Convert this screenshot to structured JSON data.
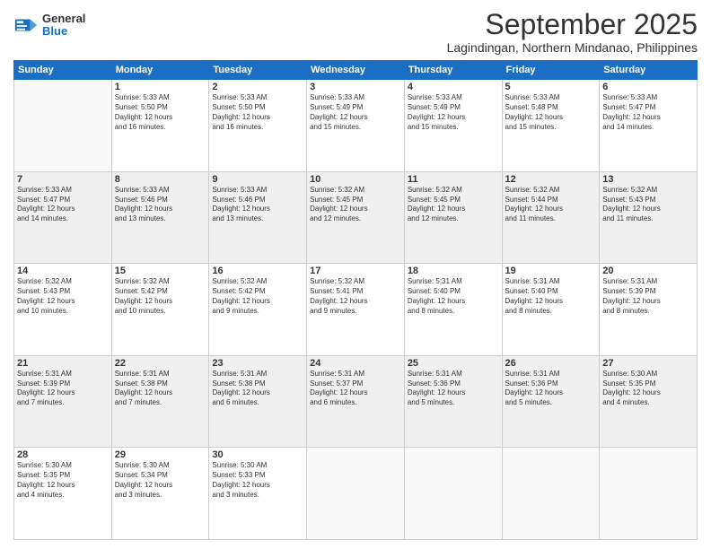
{
  "header": {
    "logo_general": "General",
    "logo_blue": "Blue",
    "month_title": "September 2025",
    "location": "Lagindingan, Northern Mindanao, Philippines"
  },
  "weekdays": [
    "Sunday",
    "Monday",
    "Tuesday",
    "Wednesday",
    "Thursday",
    "Friday",
    "Saturday"
  ],
  "weeks": [
    [
      {
        "day": "",
        "info": ""
      },
      {
        "day": "1",
        "info": "Sunrise: 5:33 AM\nSunset: 5:50 PM\nDaylight: 12 hours\nand 16 minutes."
      },
      {
        "day": "2",
        "info": "Sunrise: 5:33 AM\nSunset: 5:50 PM\nDaylight: 12 hours\nand 16 minutes."
      },
      {
        "day": "3",
        "info": "Sunrise: 5:33 AM\nSunset: 5:49 PM\nDaylight: 12 hours\nand 15 minutes."
      },
      {
        "day": "4",
        "info": "Sunrise: 5:33 AM\nSunset: 5:49 PM\nDaylight: 12 hours\nand 15 minutes."
      },
      {
        "day": "5",
        "info": "Sunrise: 5:33 AM\nSunset: 5:48 PM\nDaylight: 12 hours\nand 15 minutes."
      },
      {
        "day": "6",
        "info": "Sunrise: 5:33 AM\nSunset: 5:47 PM\nDaylight: 12 hours\nand 14 minutes."
      }
    ],
    [
      {
        "day": "7",
        "info": "Sunrise: 5:33 AM\nSunset: 5:47 PM\nDaylight: 12 hours\nand 14 minutes."
      },
      {
        "day": "8",
        "info": "Sunrise: 5:33 AM\nSunset: 5:46 PM\nDaylight: 12 hours\nand 13 minutes."
      },
      {
        "day": "9",
        "info": "Sunrise: 5:33 AM\nSunset: 5:46 PM\nDaylight: 12 hours\nand 13 minutes."
      },
      {
        "day": "10",
        "info": "Sunrise: 5:32 AM\nSunset: 5:45 PM\nDaylight: 12 hours\nand 12 minutes."
      },
      {
        "day": "11",
        "info": "Sunrise: 5:32 AM\nSunset: 5:45 PM\nDaylight: 12 hours\nand 12 minutes."
      },
      {
        "day": "12",
        "info": "Sunrise: 5:32 AM\nSunset: 5:44 PM\nDaylight: 12 hours\nand 11 minutes."
      },
      {
        "day": "13",
        "info": "Sunrise: 5:32 AM\nSunset: 5:43 PM\nDaylight: 12 hours\nand 11 minutes."
      }
    ],
    [
      {
        "day": "14",
        "info": "Sunrise: 5:32 AM\nSunset: 5:43 PM\nDaylight: 12 hours\nand 10 minutes."
      },
      {
        "day": "15",
        "info": "Sunrise: 5:32 AM\nSunset: 5:42 PM\nDaylight: 12 hours\nand 10 minutes."
      },
      {
        "day": "16",
        "info": "Sunrise: 5:32 AM\nSunset: 5:42 PM\nDaylight: 12 hours\nand 9 minutes."
      },
      {
        "day": "17",
        "info": "Sunrise: 5:32 AM\nSunset: 5:41 PM\nDaylight: 12 hours\nand 9 minutes."
      },
      {
        "day": "18",
        "info": "Sunrise: 5:31 AM\nSunset: 5:40 PM\nDaylight: 12 hours\nand 8 minutes."
      },
      {
        "day": "19",
        "info": "Sunrise: 5:31 AM\nSunset: 5:40 PM\nDaylight: 12 hours\nand 8 minutes."
      },
      {
        "day": "20",
        "info": "Sunrise: 5:31 AM\nSunset: 5:39 PM\nDaylight: 12 hours\nand 8 minutes."
      }
    ],
    [
      {
        "day": "21",
        "info": "Sunrise: 5:31 AM\nSunset: 5:39 PM\nDaylight: 12 hours\nand 7 minutes."
      },
      {
        "day": "22",
        "info": "Sunrise: 5:31 AM\nSunset: 5:38 PM\nDaylight: 12 hours\nand 7 minutes."
      },
      {
        "day": "23",
        "info": "Sunrise: 5:31 AM\nSunset: 5:38 PM\nDaylight: 12 hours\nand 6 minutes."
      },
      {
        "day": "24",
        "info": "Sunrise: 5:31 AM\nSunset: 5:37 PM\nDaylight: 12 hours\nand 6 minutes."
      },
      {
        "day": "25",
        "info": "Sunrise: 5:31 AM\nSunset: 5:36 PM\nDaylight: 12 hours\nand 5 minutes."
      },
      {
        "day": "26",
        "info": "Sunrise: 5:31 AM\nSunset: 5:36 PM\nDaylight: 12 hours\nand 5 minutes."
      },
      {
        "day": "27",
        "info": "Sunrise: 5:30 AM\nSunset: 5:35 PM\nDaylight: 12 hours\nand 4 minutes."
      }
    ],
    [
      {
        "day": "28",
        "info": "Sunrise: 5:30 AM\nSunset: 5:35 PM\nDaylight: 12 hours\nand 4 minutes."
      },
      {
        "day": "29",
        "info": "Sunrise: 5:30 AM\nSunset: 5:34 PM\nDaylight: 12 hours\nand 3 minutes."
      },
      {
        "day": "30",
        "info": "Sunrise: 5:30 AM\nSunset: 5:33 PM\nDaylight: 12 hours\nand 3 minutes."
      },
      {
        "day": "",
        "info": ""
      },
      {
        "day": "",
        "info": ""
      },
      {
        "day": "",
        "info": ""
      },
      {
        "day": "",
        "info": ""
      }
    ]
  ]
}
